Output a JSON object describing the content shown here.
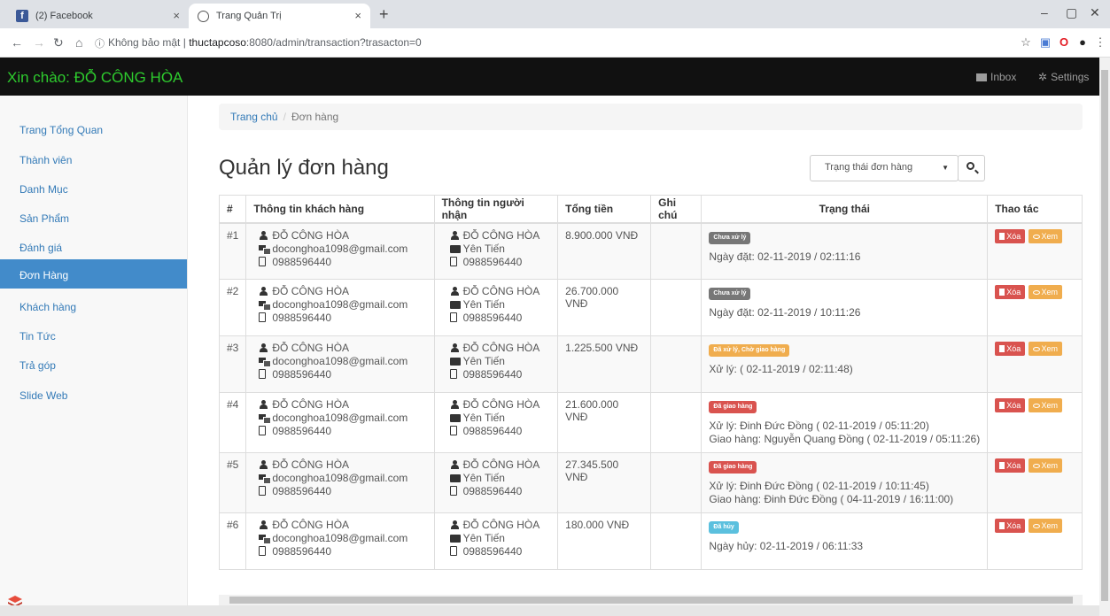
{
  "browser": {
    "tabs": [
      {
        "title": "(2) Facebook",
        "active": false
      },
      {
        "title": "Trang Quản Trị",
        "active": true
      }
    ],
    "new_tab": "+",
    "url_prefix": "Không bảo mật",
    "url_sep": " | ",
    "url_host": "thuctapcoso",
    "url_rest": ":8080/admin/transaction?trasacton=0"
  },
  "appbar": {
    "greeting": "Xin chào: ĐỖ CÔNG HÒA",
    "inbox": "Inbox",
    "settings": "Settings",
    "greeting_color": "#2ecc2e"
  },
  "sidebar": {
    "items": [
      {
        "label": "Trang Tổng Quan",
        "active": false
      },
      {
        "label": "Thành viên",
        "active": false
      },
      {
        "label": "Danh Mục",
        "active": false
      },
      {
        "label": "Sản Phẩm",
        "active": false
      },
      {
        "label": "Đánh giá",
        "active": false
      },
      {
        "label": "Đơn Hàng",
        "active": true
      },
      {
        "label": "Khách hàng",
        "active": false
      },
      {
        "label": "Tin Tức",
        "active": false
      },
      {
        "label": "Trả góp",
        "active": false
      },
      {
        "label": "Slide Web",
        "active": false
      }
    ]
  },
  "breadcrumb": {
    "home": "Trang chủ",
    "sep": "/",
    "current": "Đơn hàng"
  },
  "page": {
    "title": "Quản lý đơn hàng",
    "status_select": "Trạng thái đơn hàng"
  },
  "table": {
    "headers": [
      "#",
      "Thông tin khách hàng",
      "Thông tin người nhận",
      "Tổng tiền",
      "Ghi chú",
      "Trạng thái",
      "Thao tác"
    ],
    "delete_label": "Xóa",
    "view_label": "Xem",
    "rows": [
      {
        "id": "#1",
        "customer": {
          "name": "ĐỖ CÔNG HÒA",
          "email": "doconghoa1098@gmail.com",
          "phone": "0988596440"
        },
        "receiver": {
          "name": "ĐỖ CÔNG HÒA",
          "address": "Yên Tiến",
          "phone": "0988596440"
        },
        "total": "8.900.000 VNĐ",
        "note": "",
        "status": {
          "badge": "Chưa xử lý",
          "color": "#777777",
          "lines": [
            "Ngày đặt: 02-11-2019 / 02:11:16"
          ]
        }
      },
      {
        "id": "#2",
        "customer": {
          "name": "ĐỖ CÔNG HÒA",
          "email": "doconghoa1098@gmail.com",
          "phone": "0988596440"
        },
        "receiver": {
          "name": "ĐỖ CÔNG HÒA",
          "address": "Yên Tiến",
          "phone": "0988596440"
        },
        "total": "26.700.000 VNĐ",
        "note": "",
        "status": {
          "badge": "Chưa xử lý",
          "color": "#777777",
          "lines": [
            "Ngày đặt: 02-11-2019 / 10:11:26"
          ]
        }
      },
      {
        "id": "#3",
        "customer": {
          "name": "ĐỖ CÔNG HÒA",
          "email": "doconghoa1098@gmail.com",
          "phone": "0988596440"
        },
        "receiver": {
          "name": "ĐỖ CÔNG HÒA",
          "address": "Yên Tiến",
          "phone": "0988596440"
        },
        "total": "1.225.500 VNĐ",
        "note": "",
        "status": {
          "badge": "Đã xử lý, Chờ giao hàng",
          "color": "#f0ad4e",
          "lines": [
            "Xử lý: ( 02-11-2019 / 02:11:48)"
          ]
        }
      },
      {
        "id": "#4",
        "customer": {
          "name": "ĐỖ CÔNG HÒA",
          "email": "doconghoa1098@gmail.com",
          "phone": "0988596440"
        },
        "receiver": {
          "name": "ĐỖ CÔNG HÒA",
          "address": "Yên Tiến",
          "phone": "0988596440"
        },
        "total": "21.600.000 VNĐ",
        "note": "",
        "status": {
          "badge": "Đã giao hàng",
          "color": "#d9534f",
          "lines": [
            "Xử lý: Đinh Đức Đồng ( 02-11-2019 / 05:11:20)",
            "Giao hàng: Nguyễn Quang Đồng ( 02-11-2019 / 05:11:26)"
          ]
        }
      },
      {
        "id": "#5",
        "customer": {
          "name": "ĐỖ CÔNG HÒA",
          "email": "doconghoa1098@gmail.com",
          "phone": "0988596440"
        },
        "receiver": {
          "name": "ĐỖ CÔNG HÒA",
          "address": "Yên Tiến",
          "phone": "0988596440"
        },
        "total": "27.345.500 VNĐ",
        "note": "",
        "status": {
          "badge": "Đã giao hàng",
          "color": "#d9534f",
          "lines": [
            "Xử lý: Đinh Đức Đồng ( 02-11-2019 / 10:11:45)",
            "Giao hàng: Đinh Đức Đồng ( 04-11-2019 / 16:11:00)"
          ]
        }
      },
      {
        "id": "#6",
        "customer": {
          "name": "ĐỖ CÔNG HÒA",
          "email": "doconghoa1098@gmail.com",
          "phone": "0988596440"
        },
        "receiver": {
          "name": "ĐỖ CÔNG HÒA",
          "address": "Yên Tiến",
          "phone": "0988596440"
        },
        "total": "180.000 VNĐ",
        "note": "",
        "status": {
          "badge": "Đã hủy",
          "color": "#5bc0de",
          "lines": [
            "Ngày hủy: 02-11-2019 / 06:11:33"
          ]
        }
      }
    ]
  }
}
